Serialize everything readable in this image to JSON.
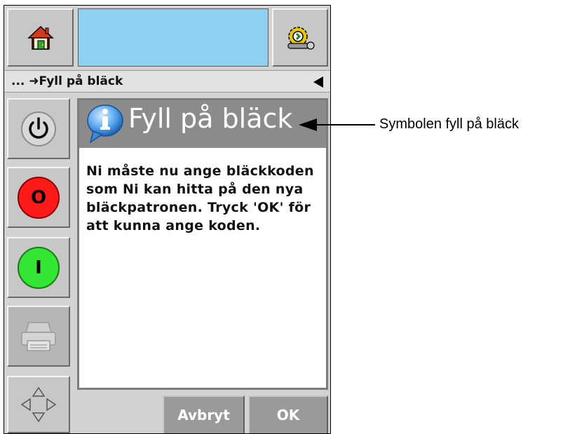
{
  "breadcrumb": {
    "path": "... ➜Fyll på bläck"
  },
  "dialog": {
    "title": "Fyll på bläck",
    "message": "Ni måste nu ange bläckkoden som Ni kan hitta på den nya bläckpatronen. Tryck 'OK' för att kunna ange koden."
  },
  "footer": {
    "cancel_label": "Avbryt",
    "ok_label": "OK"
  },
  "sidebar": {
    "stop_label": "O",
    "start_label": "I"
  },
  "annotation": {
    "label": "Symbolen fyll på bläck"
  },
  "icons": {
    "home": "home-icon",
    "settings": "settings-gear-wrench-icon",
    "power": "power-icon",
    "info": "info-speech-bubble-icon",
    "print": "printer-icon",
    "navigation": "direction-arrows-icon",
    "back": "back-arrow-icon"
  },
  "colors": {
    "display_bar": "#8fd0f2",
    "stop_button": "#ff1a1a",
    "start_button": "#33e633",
    "header": "#8b8b8b"
  }
}
